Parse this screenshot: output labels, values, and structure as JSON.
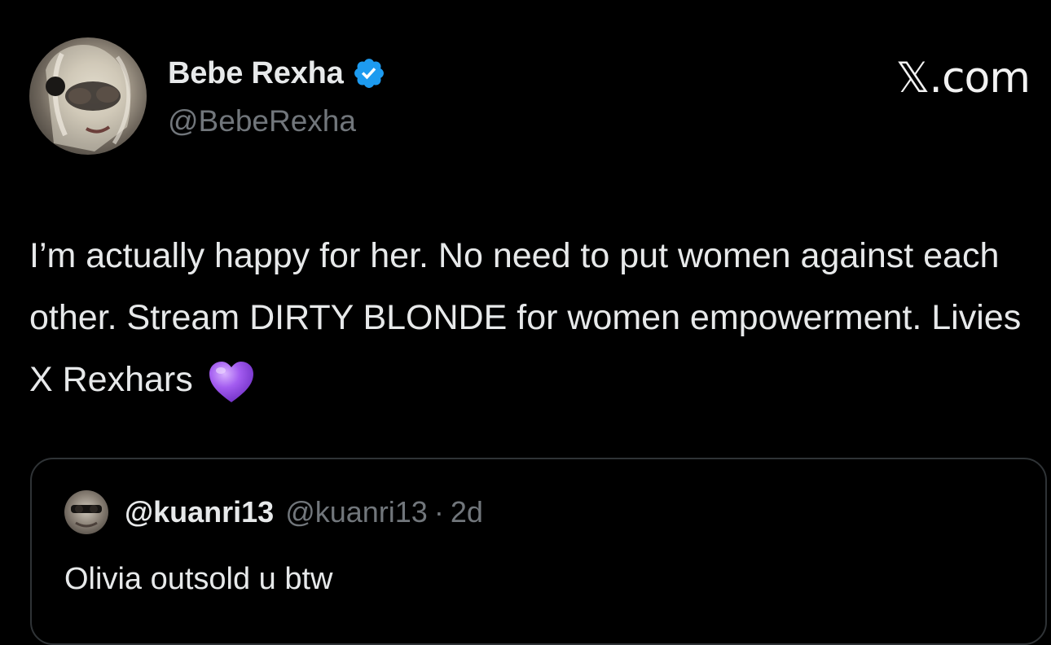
{
  "tweet": {
    "author": {
      "name": "Bebe Rexha",
      "handle": "@BebeRexha",
      "verified": true,
      "verified_color": "#1d9bf0"
    },
    "brand": "𝕏.com",
    "text": "I’m actually happy for her. No need to put women against each other. Stream DIRTY BLONDE for women empowerment. Livies X Rexhars",
    "emoji": "purple-heart",
    "emoji_color": "#a35cf0"
  },
  "quoted_tweet": {
    "name": "@kuanri13",
    "handle": "@kuanri13",
    "separator": "·",
    "time": "2d",
    "text": "Olivia outsold u btw"
  },
  "colors": {
    "background": "#000000",
    "primary_text": "#e7e9ea",
    "secondary_text": "#71767b",
    "border": "#2f3336"
  }
}
